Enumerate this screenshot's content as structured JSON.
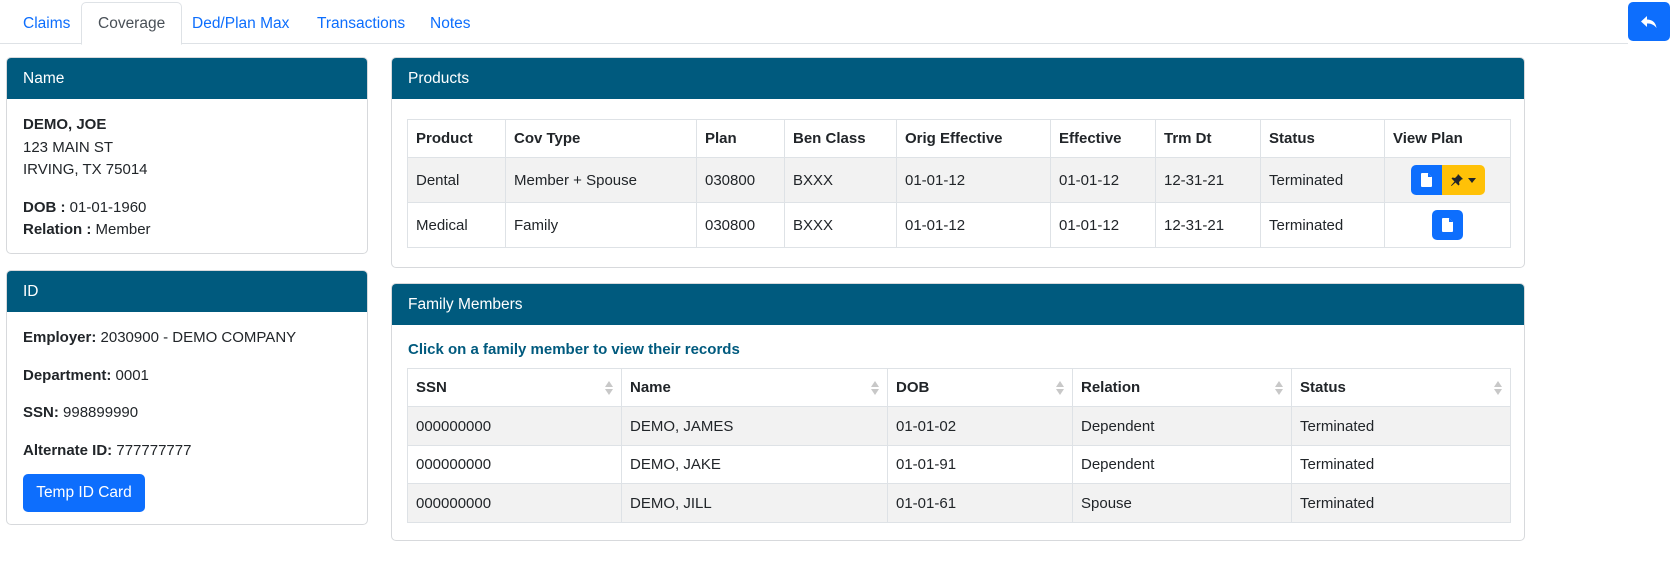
{
  "tabs": [
    {
      "label": "Claims",
      "active": false
    },
    {
      "label": "Coverage",
      "active": true
    },
    {
      "label": "Ded/Plan Max",
      "active": false
    },
    {
      "label": "Transactions",
      "active": false
    },
    {
      "label": "Notes",
      "active": false
    }
  ],
  "name_card": {
    "header": "Name",
    "full_name": "DEMO, JOE",
    "address1": "123 MAIN ST",
    "address2": "IRVING, TX 75014",
    "dob_label": "DOB :",
    "dob": "01-01-1960",
    "relation_label": "Relation :",
    "relation": "Member"
  },
  "id_card": {
    "header": "ID",
    "employer_label": "Employer:",
    "employer": "2030900 - DEMO COMPANY",
    "department_label": "Department:",
    "department": "0001",
    "ssn_label": "SSN:",
    "ssn": "998899990",
    "alt_id_label": "Alternate ID:",
    "alt_id": "777777777",
    "temp_card_button": "Temp ID Card"
  },
  "products": {
    "header": "Products",
    "columns": [
      "Product",
      "Cov Type",
      "Plan",
      "Ben Class",
      "Orig Effective",
      "Effective",
      "Trm Dt",
      "Status",
      "View Plan"
    ],
    "rows": [
      [
        "Dental",
        "Member + Spouse",
        "030800",
        "BXXX",
        "01-01-12",
        "01-01-12",
        "12-31-21",
        "Terminated"
      ],
      [
        "Medical",
        "Family",
        "030800",
        "BXXX",
        "01-01-12",
        "01-01-12",
        "12-31-21",
        "Terminated"
      ]
    ]
  },
  "family": {
    "header": "Family Members",
    "hint": "Click on a family member to view their records",
    "columns": [
      "SSN",
      "Name",
      "DOB",
      "Relation",
      "Status"
    ],
    "rows": [
      [
        "000000000",
        "DEMO, JAMES",
        "01-01-02",
        "Dependent",
        "Terminated"
      ],
      [
        "000000000",
        "DEMO, JAKE",
        "01-01-91",
        "Dependent",
        "Terminated"
      ],
      [
        "000000000",
        "DEMO, JILL",
        "01-01-61",
        "Spouse",
        "Terminated"
      ]
    ]
  },
  "icons": {
    "back": "reply-arrow-icon",
    "doc": "document-icon",
    "pin": "pushpin-icon",
    "caret": "caret-down-icon",
    "sort": "sort-icon"
  },
  "colors": {
    "header_bg": "#005a7e",
    "primary": "#0d6efd",
    "warning": "#ffc107",
    "row_shade": "#f2f2f2"
  }
}
